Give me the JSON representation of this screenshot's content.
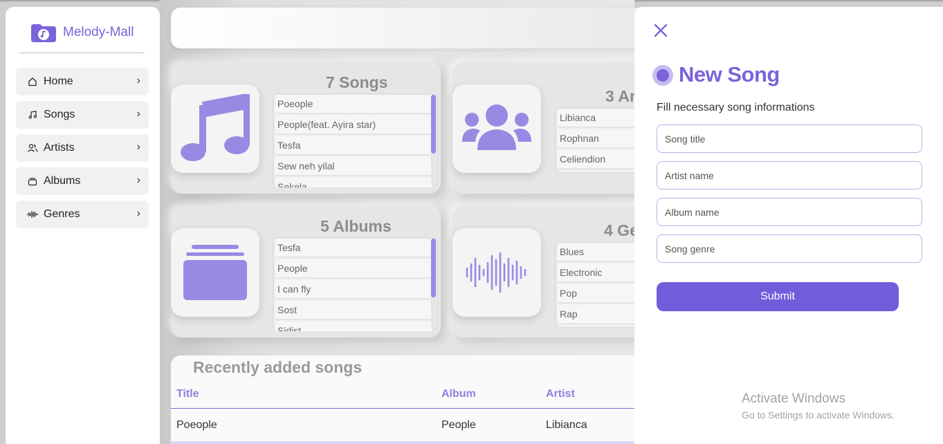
{
  "brand": {
    "name": "Melody-Mall"
  },
  "nav": [
    {
      "label": "Home",
      "icon": "home-icon"
    },
    {
      "label": "Songs",
      "icon": "music-note-icon"
    },
    {
      "label": "Artists",
      "icon": "users-icon"
    },
    {
      "label": "Albums",
      "icon": "album-icon"
    },
    {
      "label": "Genres",
      "icon": "waveform-icon"
    }
  ],
  "nav_chevron": "›",
  "cards": {
    "songs": {
      "title": "7 Songs",
      "items": [
        "Poeople",
        "People(feat. Ayira star)",
        "Tesfa",
        "Sew neh yilal",
        "Sekela"
      ]
    },
    "artists": {
      "title": "3 Ar",
      "items": [
        "Libianca",
        "Rophnan",
        "Celiendion"
      ]
    },
    "albums": {
      "title": "5 Albums",
      "items": [
        "Tesfa",
        "People",
        "I can fly",
        "Sost",
        "Sidist"
      ]
    },
    "genres": {
      "title": "4 Ge",
      "items": [
        "Blues",
        "Electronic",
        "Pop",
        "Rap"
      ]
    }
  },
  "recent": {
    "title": "Recently added songs",
    "columns": [
      "Title",
      "Album",
      "Artist"
    ],
    "rows": [
      {
        "title": "Poeople",
        "album": "People",
        "artist": "Libianca"
      }
    ]
  },
  "drawer": {
    "title": "New Song",
    "subtitle": "Fill necessary song informations",
    "fields": {
      "title_placeholder": "Song title",
      "artist_placeholder": "Artist name",
      "album_placeholder": "Album name",
      "genre_placeholder": "Song genre"
    },
    "submit_label": "Submit"
  },
  "watermark": {
    "line1": "Activate Windows",
    "line2": "Go to Settings to activate Windows."
  },
  "colors": {
    "accent": "#7b63da",
    "icon_fill": "#978ae3"
  }
}
